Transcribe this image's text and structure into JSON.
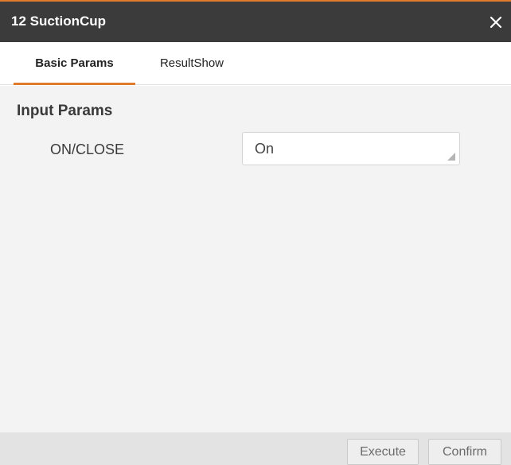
{
  "window": {
    "title": "12 SuctionCup"
  },
  "tabs": [
    {
      "label": "Basic Params",
      "active": true
    },
    {
      "label": "ResultShow",
      "active": false
    }
  ],
  "input_params": {
    "section_title": "Input Params",
    "fields": [
      {
        "label": "ON/CLOSE",
        "value": "On"
      }
    ]
  },
  "footer": {
    "execute_label": "Execute",
    "confirm_label": "Confirm"
  },
  "colors": {
    "accent": "#e07a2c",
    "titlebar": "#3b3b3b",
    "content_bg": "#f3f3f3"
  },
  "icons": {
    "close": "close-icon",
    "select_handle": "resize-grip-icon"
  }
}
